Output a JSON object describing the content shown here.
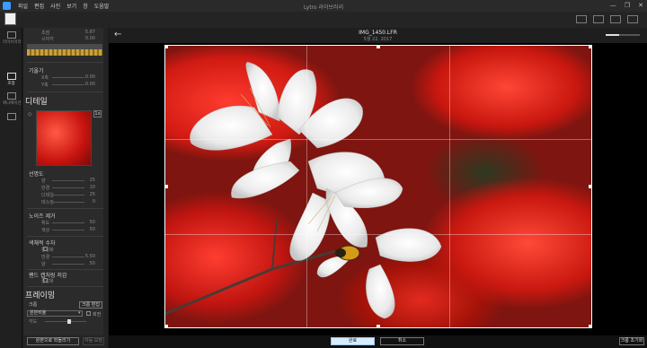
{
  "window": {
    "title": "Lytro 라이브러리",
    "menu": [
      "파일",
      "편집",
      "사진",
      "보기",
      "창",
      "도움말"
    ],
    "controls": [
      "—",
      "❐",
      "✕"
    ]
  },
  "rail": [
    {
      "label": "라이브러리",
      "active": false
    },
    {
      "label": "조정",
      "active": true
    },
    {
      "label": "애니메이션",
      "active": false
    },
    {
      "label": "",
      "active": false
    }
  ],
  "panel": {
    "top_rows": [
      {
        "label": "초점",
        "value": "5.87"
      },
      {
        "label": "시야각",
        "value": "0.00"
      }
    ],
    "tilt": {
      "title": "기울기",
      "rows": [
        {
          "label": "X축",
          "value": "0.00"
        },
        {
          "label": "Y축",
          "value": "0.00"
        }
      ]
    },
    "detail_heading": "디테일",
    "detail_badge": "1x",
    "sharpness": {
      "title": "선명도",
      "rows": [
        {
          "label": "양",
          "value": "25"
        },
        {
          "label": "반경",
          "value": "10"
        },
        {
          "label": "디테일",
          "value": "25"
        },
        {
          "label": "마스킹",
          "value": "0"
        }
      ]
    },
    "noise": {
      "title": "노이즈 제거",
      "rows": [
        {
          "label": "휘도",
          "value": "50"
        },
        {
          "label": "색상",
          "value": "50"
        }
      ]
    },
    "aberration": {
      "title": "색채적 수차",
      "enable_label": "활성화",
      "rows": [
        {
          "label": "반경",
          "value": "5.50"
        },
        {
          "label": "양",
          "value": "50"
        }
      ]
    },
    "pan_noise": {
      "title": "팬드 캡처링 저감",
      "enable_label": "활성화"
    },
    "framing_heading": "프레이밍",
    "crop": {
      "label": "크롭",
      "edit_button": "크롭 편집",
      "ratio_value": "원본비율",
      "invert_label": "회전",
      "angle_label": "각도",
      "slider_fraction": 0.55
    },
    "reset_button": "원본으로 되돌리기",
    "auto_button": "자동 보정"
  },
  "viewer": {
    "back_icon": "←",
    "filename": "IMG_1450.LFR",
    "date": "5월 22, 2017",
    "zoom_fraction": 0.4
  },
  "actions": {
    "ok": "완료",
    "cancel": "취소",
    "crop_reset": "크롭 초기화"
  }
}
